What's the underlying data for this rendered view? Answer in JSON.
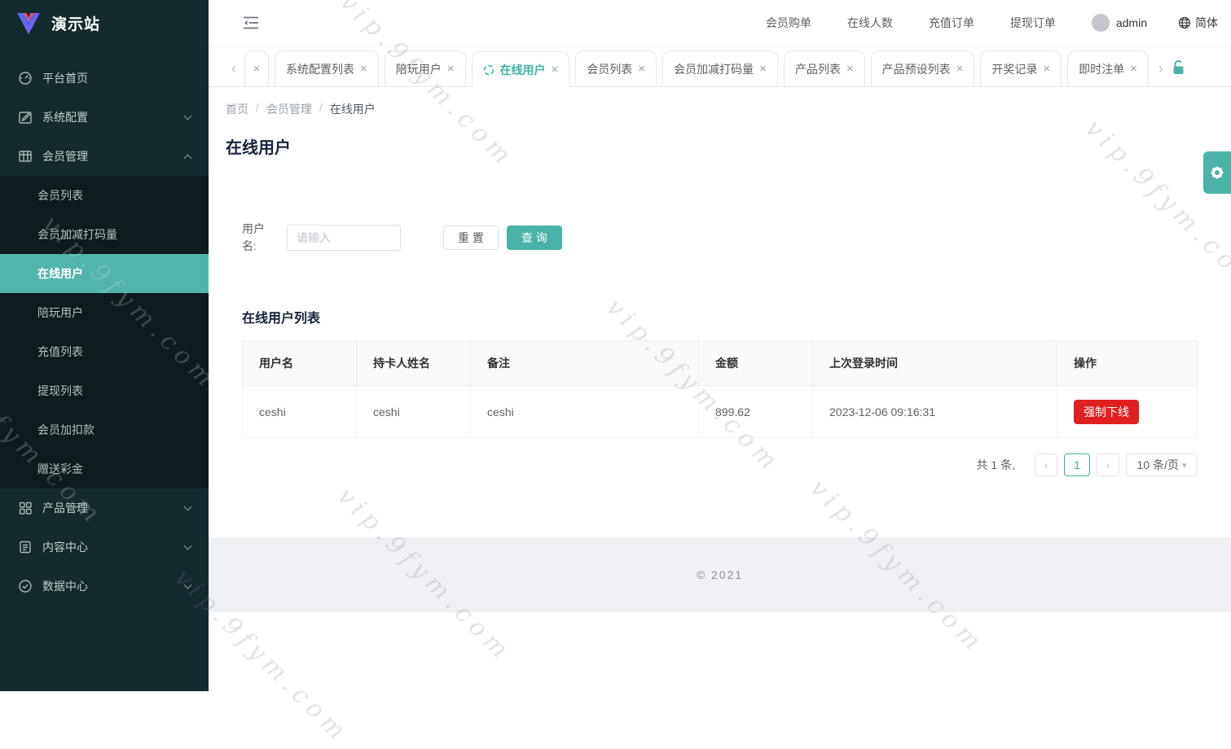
{
  "app": {
    "title": "演示站",
    "watermark": "vip.9fym.com"
  },
  "colors": {
    "accent": "#45b2a6",
    "sidebar_active": "#52b5ab",
    "danger": "#e01f1f",
    "sidebar_bg": "#152a2d",
    "submenu_bg": "#0d1c1f",
    "footer_bg": "#eef0f3"
  },
  "icons": {
    "close": "×",
    "nav_left": "‹",
    "nav_right": "›",
    "page_prev": "‹",
    "page_next": "›",
    "caret_down": "▾"
  },
  "topbar": {
    "links": [
      "会员购单",
      "在线人数",
      "充值订单",
      "提现订单"
    ],
    "username": "admin",
    "language": "简体"
  },
  "tabs": {
    "items": [
      {
        "label": "系统配置列表",
        "active": false
      },
      {
        "label": "陪玩用户",
        "active": false
      },
      {
        "label": "在线用户",
        "active": true
      },
      {
        "label": "会员列表",
        "active": false
      },
      {
        "label": "会员加减打码量",
        "active": false
      },
      {
        "label": "产品列表",
        "active": false
      },
      {
        "label": "产品预设列表",
        "active": false
      },
      {
        "label": "开奖记录",
        "active": false
      },
      {
        "label": "即时注单",
        "active": false
      }
    ]
  },
  "sidebar": {
    "items": [
      {
        "label": "平台首页"
      },
      {
        "label": "系统配置"
      },
      {
        "label": "会员管理"
      },
      {
        "label": "产品管理"
      },
      {
        "label": "内容中心"
      },
      {
        "label": "数据中心"
      }
    ],
    "submenu": [
      "会员列表",
      "会员加减打码量",
      "在线用户",
      "陪玩用户",
      "充值列表",
      "提现列表",
      "会员加扣款",
      "赠送彩金"
    ],
    "active_submenu": "在线用户"
  },
  "breadcrumb": {
    "items": [
      "首页",
      "会员管理",
      "在线用户"
    ],
    "separator": "/"
  },
  "page": {
    "title": "在线用户"
  },
  "filter": {
    "label": "用户名:",
    "placeholder": "请输入",
    "reset_label": "重 置",
    "search_label": "查 询"
  },
  "table": {
    "title": "在线用户列表",
    "columns": [
      "用户名",
      "持卡人姓名",
      "备注",
      "金额",
      "上次登录时间",
      "操作"
    ],
    "row": {
      "username": "ceshi",
      "cardholder": "ceshi",
      "remark": "ceshi",
      "amount": "899.62",
      "last_login": "2023-12-06 09:16:31",
      "action": "强制下线"
    }
  },
  "pagination": {
    "total": "共 1 条,",
    "current": "1",
    "page_size": "10 条/页"
  },
  "footer": {
    "text": "© 2021"
  }
}
